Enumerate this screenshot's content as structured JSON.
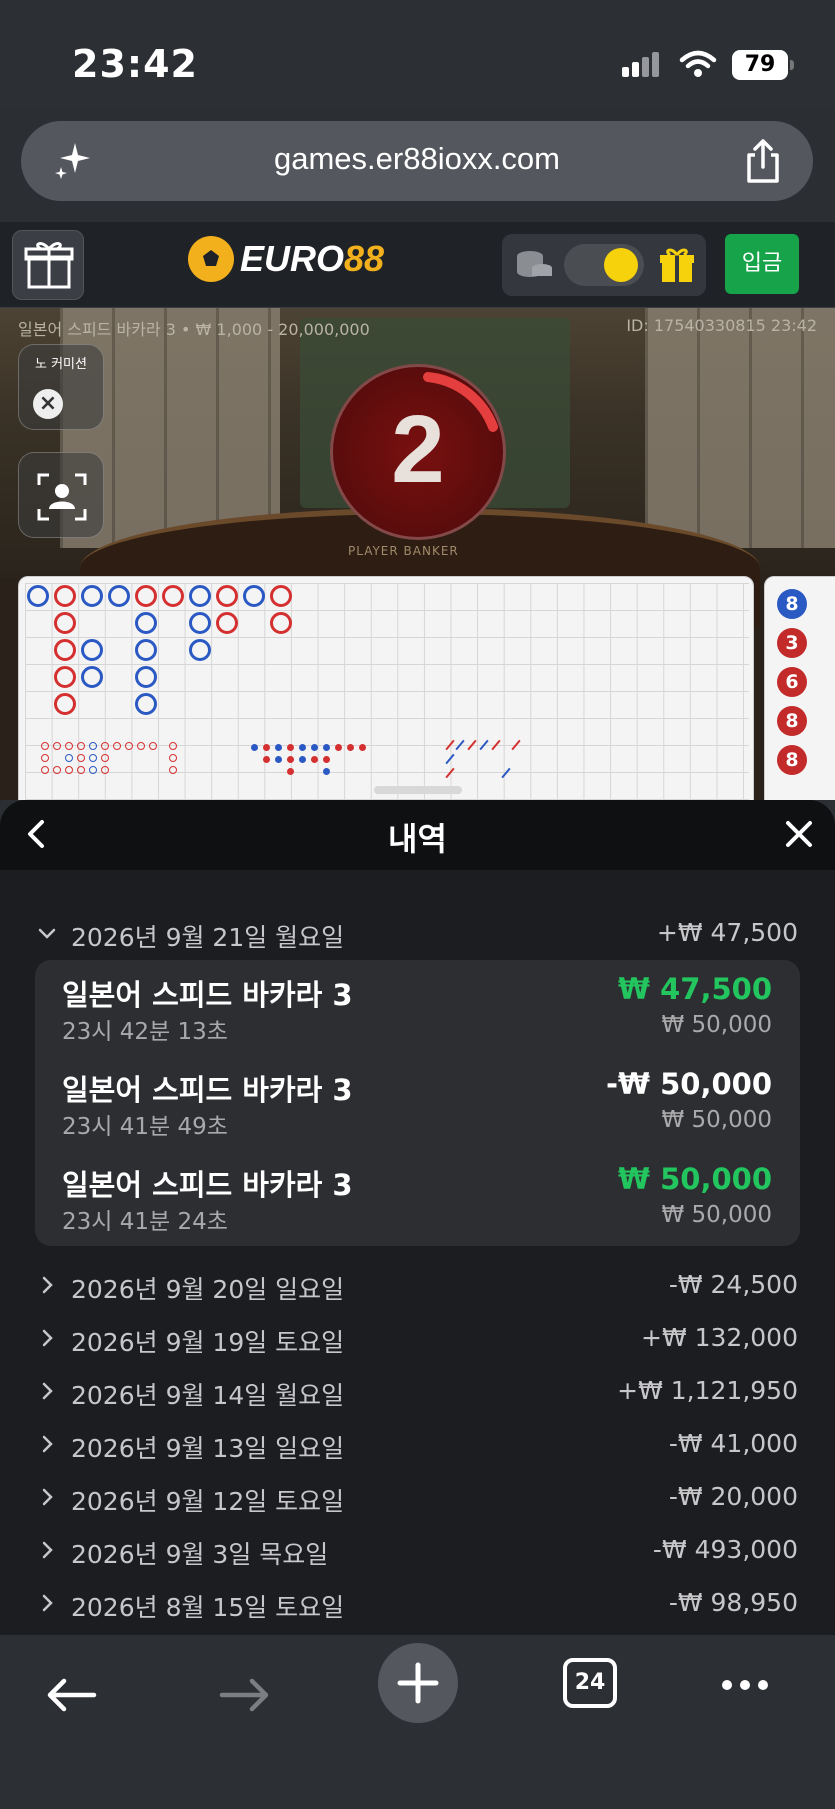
{
  "status_bar": {
    "time": "23:42",
    "battery": "79"
  },
  "browser": {
    "url": "games.er88ioxx.com",
    "tabs_count": "24"
  },
  "site": {
    "logo_text": "EURO",
    "logo_num": "88",
    "deposit_label": "입금",
    "accent_color": "#f2b01c",
    "deposit_color": "#16a34a"
  },
  "game": {
    "info": "일본어 스피드 바카라 3 • ₩ 1,000 - 20,000,000",
    "id_time": "ID: 17540330815 23:42",
    "timer": "2",
    "no_commission_label": "노 커미션",
    "table_text": "PLAYER   BANKER",
    "road_numbers": [
      {
        "n": "8",
        "c": "b"
      },
      {
        "n": "3",
        "c": "r"
      },
      {
        "n": "6",
        "c": "r"
      },
      {
        "n": "8",
        "c": "r"
      },
      {
        "n": "8",
        "c": "r"
      }
    ]
  },
  "history": {
    "title": "내역",
    "expanded_day": {
      "label": "2026년 9월 21일 월요일",
      "total": "+₩ 47,500"
    },
    "bets": [
      {
        "name": "일본어 스피드 바카라 3",
        "time": "23시 42분 13초",
        "result": "₩ 47,500",
        "stake": "₩ 50,000",
        "type": "win"
      },
      {
        "name": "일본어 스피드 바카라 3",
        "time": "23시 41분 49초",
        "result": "-₩ 50,000",
        "stake": "₩ 50,000",
        "type": "loss"
      },
      {
        "name": "일본어 스피드 바카라 3",
        "time": "23시 41분 24초",
        "result": "₩ 50,000",
        "stake": "₩ 50,000",
        "type": "win"
      }
    ],
    "days": [
      {
        "label": "2026년 9월 20일 일요일",
        "total": "-₩ 24,500"
      },
      {
        "label": "2026년 9월 19일 토요일",
        "total": "+₩ 132,000"
      },
      {
        "label": "2026년 9월 14일 월요일",
        "total": "+₩ 1,121,950"
      },
      {
        "label": "2026년 9월 13일 일요일",
        "total": "-₩ 41,000"
      },
      {
        "label": "2026년 9월 12일 토요일",
        "total": "-₩ 20,000"
      },
      {
        "label": "2026년 9월 3일 목요일",
        "total": "-₩ 493,000"
      },
      {
        "label": "2026년 8월 15일 토요일",
        "total": "-₩ 98,950"
      }
    ],
    "win_color": "#22c55e"
  }
}
